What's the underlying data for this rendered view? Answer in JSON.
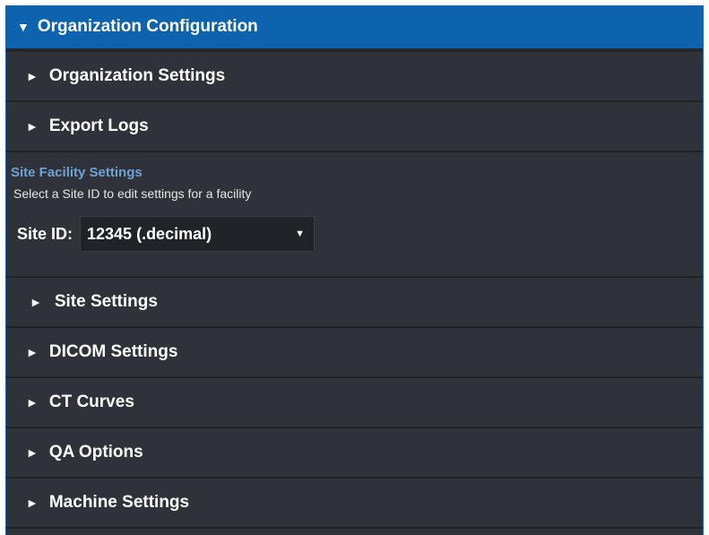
{
  "header": {
    "arrow_icon": "▼",
    "title": "Organization Configuration"
  },
  "org_sections": [
    {
      "label": "Organization Settings"
    },
    {
      "label": "Export Logs"
    }
  ],
  "site_facility": {
    "title": "Site Facility Settings",
    "description": "Select a Site ID to edit settings for a facility",
    "site_id_label": "Site ID:",
    "site_id_value": "12345 (.decimal)",
    "caret_icon": "▼"
  },
  "site_sections": [
    {
      "label": "Site Settings"
    },
    {
      "label": "DICOM Settings"
    },
    {
      "label": "CT Curves"
    },
    {
      "label": "QA Options"
    },
    {
      "label": "Machine Settings"
    }
  ],
  "collapsed_arrow_icon": "►",
  "colors": {
    "header_bg": "#0d63ad",
    "panel_bg": "#2f3238",
    "accent_text": "#6ea3d6"
  }
}
